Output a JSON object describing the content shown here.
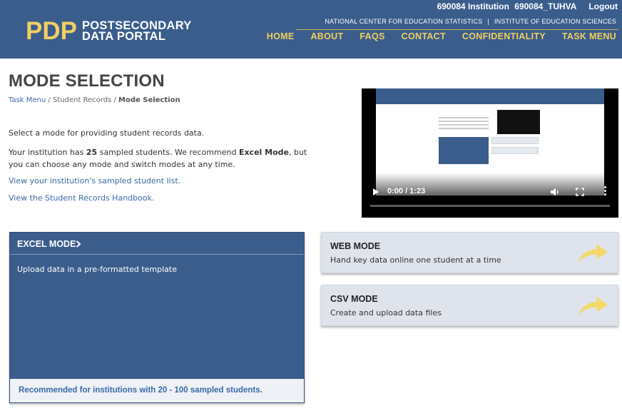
{
  "header": {
    "logo_mark": "PDP",
    "logo_line1": "POSTSECONDARY",
    "logo_line2": "DATA PORTAL",
    "user": {
      "institution": "690084 Institution",
      "username": "690084_TUHVA",
      "logout": "Logout"
    },
    "agency": {
      "nces": "NATIONAL CENTER FOR EDUCATION STATISTICS",
      "separator": "|",
      "ies": "INSTITUTE OF EDUCATION SCIENCES"
    },
    "nav": [
      "HOME",
      "ABOUT",
      "FAQS",
      "CONTACT",
      "CONFIDENTIALITY",
      "TASK MENU"
    ]
  },
  "page": {
    "title": "MODE SELECTION",
    "breadcrumb": {
      "task_menu": "Task Menu",
      "sep1": " / ",
      "student_records": "Student Records",
      "sep2": " / ",
      "current": "Mode Selection"
    },
    "intro": "Select a mode for providing student records data.",
    "info_part1": "Your institution has ",
    "sampled_count": "25",
    "info_part2": " sampled students. We recommend ",
    "recommended_mode": "Excel Mode",
    "info_part3": ", but you can choose any mode and switch modes at any time.",
    "link_sampled": "View your institution's sampled student list.",
    "link_handbook": "View the Student Records Handbook."
  },
  "video": {
    "time": "0:00 / 1:23"
  },
  "modes": {
    "excel": {
      "title": "EXCEL MODE",
      "description": "Upload data in a pre-formatted template",
      "recommendation": "Recommended for institutions with 20 - 100 sampled students."
    },
    "web": {
      "title": "WEB MODE",
      "description": "Hand key data online one student at a time"
    },
    "csv": {
      "title": "CSV MODE",
      "description": "Create and upload data files"
    }
  },
  "colors": {
    "header_bg": "#3a5d8c",
    "accent_gold": "#f2cf62",
    "link_blue": "#3a6aa6",
    "card_gray": "#dfe4ec",
    "arrow_yellow": "#f5d86a"
  }
}
